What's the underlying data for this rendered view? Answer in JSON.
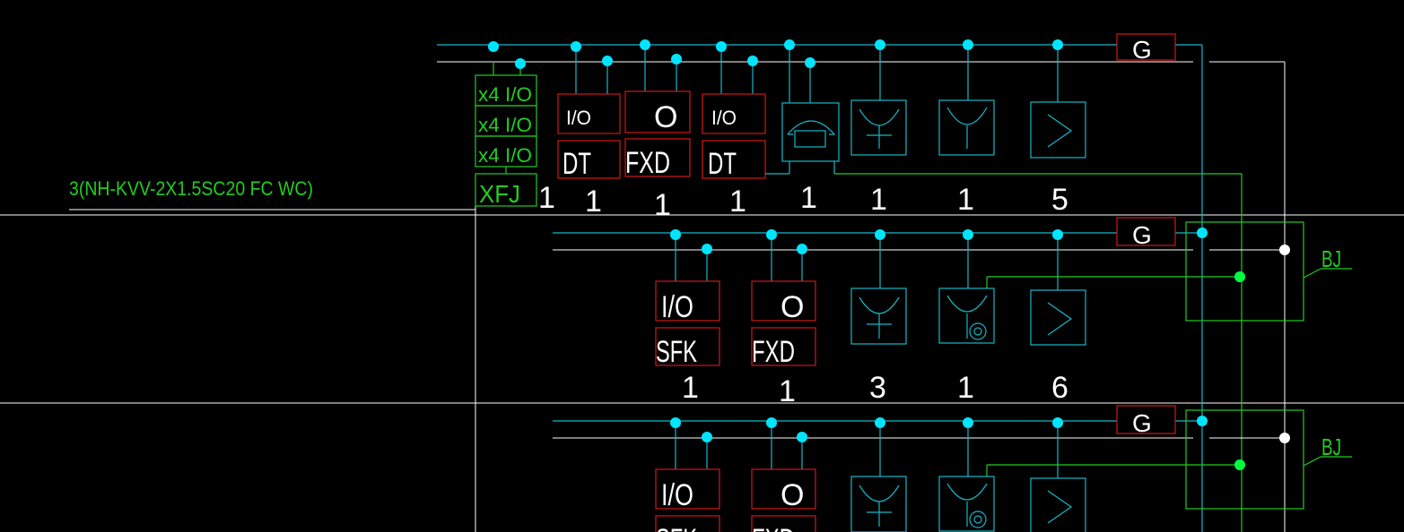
{
  "cable_label": "3(NH-KVV-2X1.5SC20 FC WC)",
  "module_box": {
    "rows": [
      "x4 I/O",
      "x4 I/O",
      "x4 I/O"
    ],
    "label": "XFJ"
  },
  "floors": [
    {
      "bus_label": "G",
      "devices": [
        {
          "kind": "module",
          "top": "I/O",
          "bottom": "DT",
          "count": "1"
        },
        {
          "kind": "module",
          "top": "O",
          "bottom": "FXD",
          "count": "1"
        },
        {
          "kind": "module",
          "top": "I/O",
          "bottom": "DT",
          "count": "1"
        },
        {
          "kind": "phone",
          "count": "1"
        },
        {
          "kind": "smoke-detector",
          "count": "1"
        },
        {
          "kind": "heat-detector",
          "count": "1"
        },
        {
          "kind": "flame-symbol",
          "count": "5"
        }
      ],
      "first_count": "1"
    },
    {
      "bus_label": "G",
      "alarm_label": "BJ",
      "devices": [
        {
          "kind": "module",
          "top": "I/O",
          "bottom": "SFK",
          "count": "1"
        },
        {
          "kind": "module",
          "top": "O",
          "bottom": "FXD",
          "count": "1"
        },
        {
          "kind": "smoke-detector",
          "count": "3"
        },
        {
          "kind": "manual-alarm",
          "count": "1"
        },
        {
          "kind": "flame-symbol",
          "count": "6"
        }
      ]
    },
    {
      "bus_label": "G",
      "alarm_label": "BJ",
      "devices": [
        {
          "kind": "module",
          "top": "I/O",
          "bottom": "SFK"
        },
        {
          "kind": "module",
          "top": "O",
          "bottom": "FXD"
        },
        {
          "kind": "smoke-detector"
        },
        {
          "kind": "manual-alarm"
        },
        {
          "kind": "flame-symbol"
        }
      ]
    }
  ],
  "colors": {
    "cyan": "#00e5ff",
    "teal": "#16b8c8",
    "red": "#d01818",
    "green": "#22cc22",
    "white": "#ffffff",
    "green_dot": "#00ff40"
  }
}
